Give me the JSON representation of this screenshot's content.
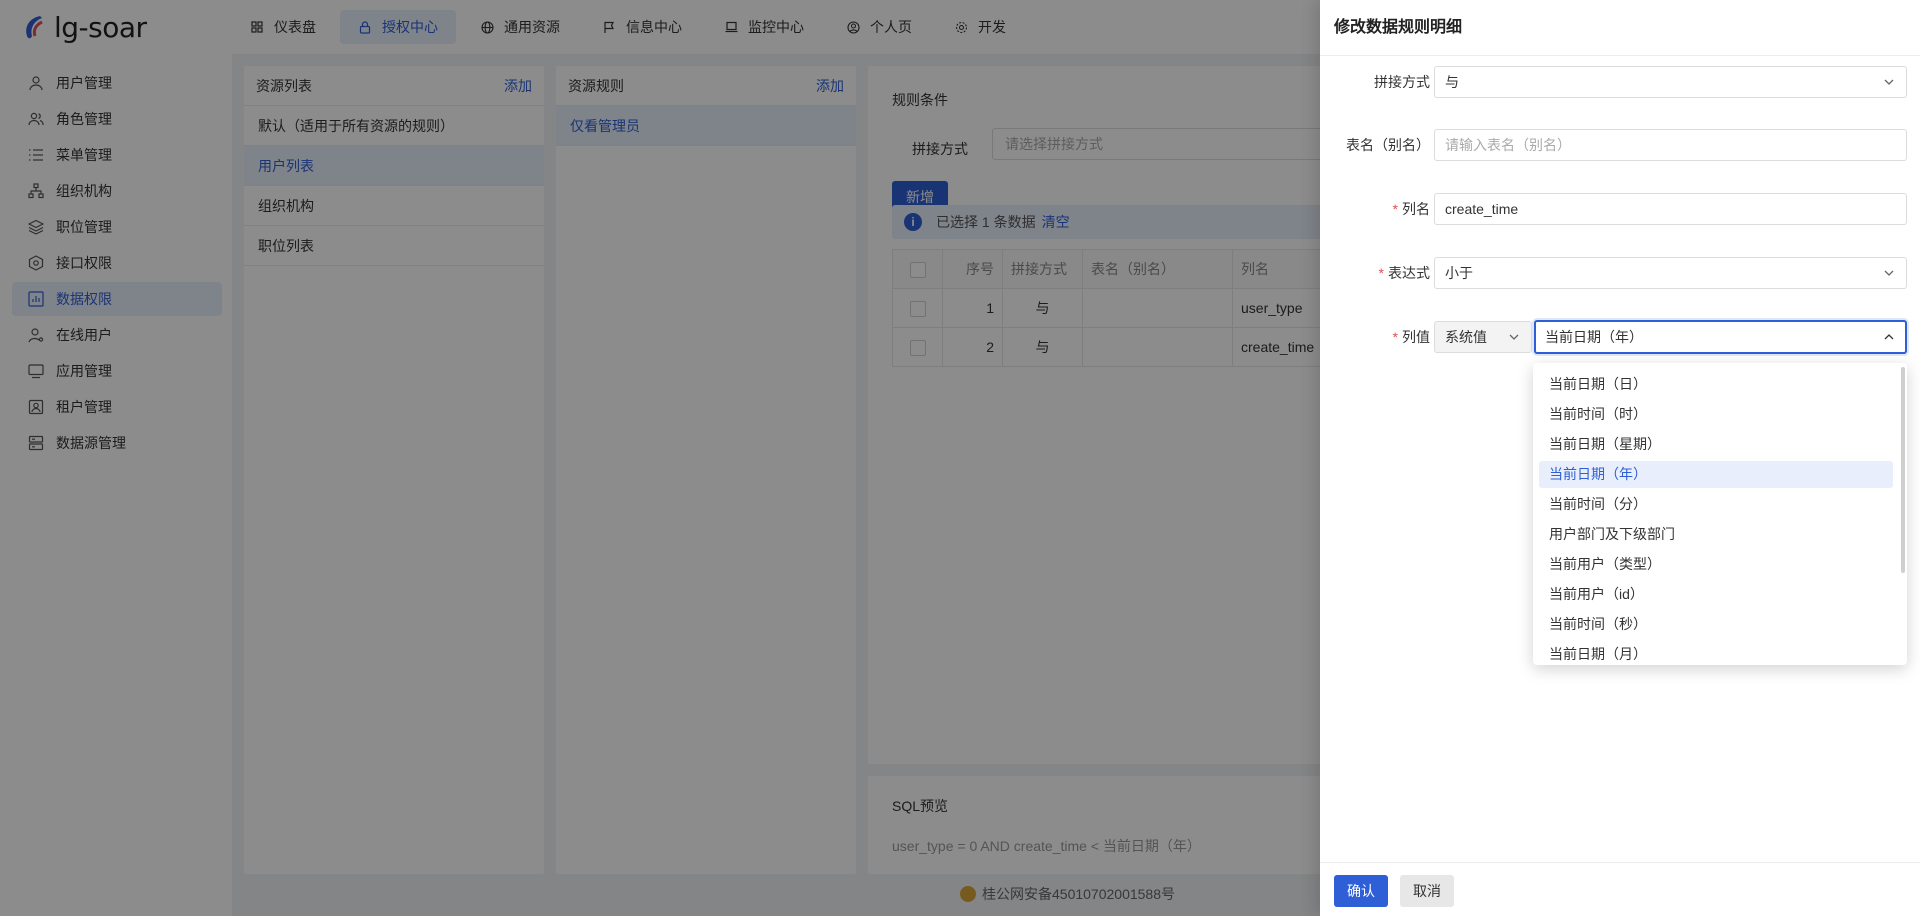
{
  "app": {
    "name": "lg-soar"
  },
  "top_nav": [
    {
      "label": "仪表盘",
      "icon": "grid-icon"
    },
    {
      "label": "授权中心",
      "icon": "lock-icon",
      "active": true
    },
    {
      "label": "通用资源",
      "icon": "globe-icon"
    },
    {
      "label": "信息中心",
      "icon": "flag-icon"
    },
    {
      "label": "监控中心",
      "icon": "laptop-icon"
    },
    {
      "label": "个人页",
      "icon": "user-circle-icon"
    },
    {
      "label": "开发",
      "icon": "gear-icon"
    }
  ],
  "sidebar": [
    {
      "label": "用户管理",
      "icon": "user-icon"
    },
    {
      "label": "角色管理",
      "icon": "users-icon"
    },
    {
      "label": "菜单管理",
      "icon": "list-icon"
    },
    {
      "label": "组织机构",
      "icon": "org-icon"
    },
    {
      "label": "职位管理",
      "icon": "layers-icon"
    },
    {
      "label": "接口权限",
      "icon": "api-icon"
    },
    {
      "label": "数据权限",
      "icon": "chart-icon",
      "active": true
    },
    {
      "label": "在线用户",
      "icon": "user-online-icon"
    },
    {
      "label": "应用管理",
      "icon": "monitor-icon"
    },
    {
      "label": "租户管理",
      "icon": "id-card-icon"
    },
    {
      "label": "数据源管理",
      "icon": "database-icon"
    }
  ],
  "resource_list": {
    "title": "资源列表",
    "add": "添加",
    "items": [
      "默认（适用于所有资源的规则）",
      "用户列表",
      "组织机构",
      "职位列表"
    ],
    "active_index": 1
  },
  "resource_rules": {
    "title": "资源规则",
    "add": "添加",
    "items": [
      "仅看管理员"
    ]
  },
  "rule_conditions": {
    "title": "规则条件",
    "join_label": "拼接方式",
    "join_placeholder": "请选择拼接方式",
    "new_button": "新增",
    "alert_text": "已选择 1 条数据",
    "alert_clear": "清空",
    "columns": [
      "序号",
      "拼接方式",
      "表名（别名）",
      "列名"
    ],
    "rows": [
      {
        "no": "1",
        "join": "与",
        "table": "",
        "column": "user_type"
      },
      {
        "no": "2",
        "join": "与",
        "table": "",
        "column": "create_time"
      }
    ]
  },
  "sql_preview": {
    "title": "SQL预览",
    "text": "user_type = 0 AND create_time < 当前日期（年）"
  },
  "footer": {
    "icp": "桂公网安备45010702001588号"
  },
  "drawer": {
    "title": "修改数据规则明细",
    "fields": {
      "join": {
        "label": "拼接方式",
        "value": "与"
      },
      "table": {
        "label": "表名（别名）",
        "placeholder": "请输入表名（别名）"
      },
      "column": {
        "label": "列名",
        "value": "create_time"
      },
      "expression": {
        "label": "表达式",
        "value": "小于"
      },
      "value": {
        "label": "列值",
        "type": "系统值",
        "value": "当前日期（年）"
      }
    },
    "options": [
      "当前日期（日）",
      "当前时间（时）",
      "当前日期（星期）",
      "当前日期（年）",
      "当前时间（分）",
      "用户部门及下级部门",
      "当前用户（类型）",
      "当前用户（id）",
      "当前时间（秒）",
      "当前日期（月）"
    ],
    "selected_option_index": 3,
    "confirm": "确认",
    "cancel": "取消"
  },
  "colors": {
    "primary": "#2f5fd6",
    "active_bg": "#e8eefc",
    "required": "#e34d59"
  }
}
